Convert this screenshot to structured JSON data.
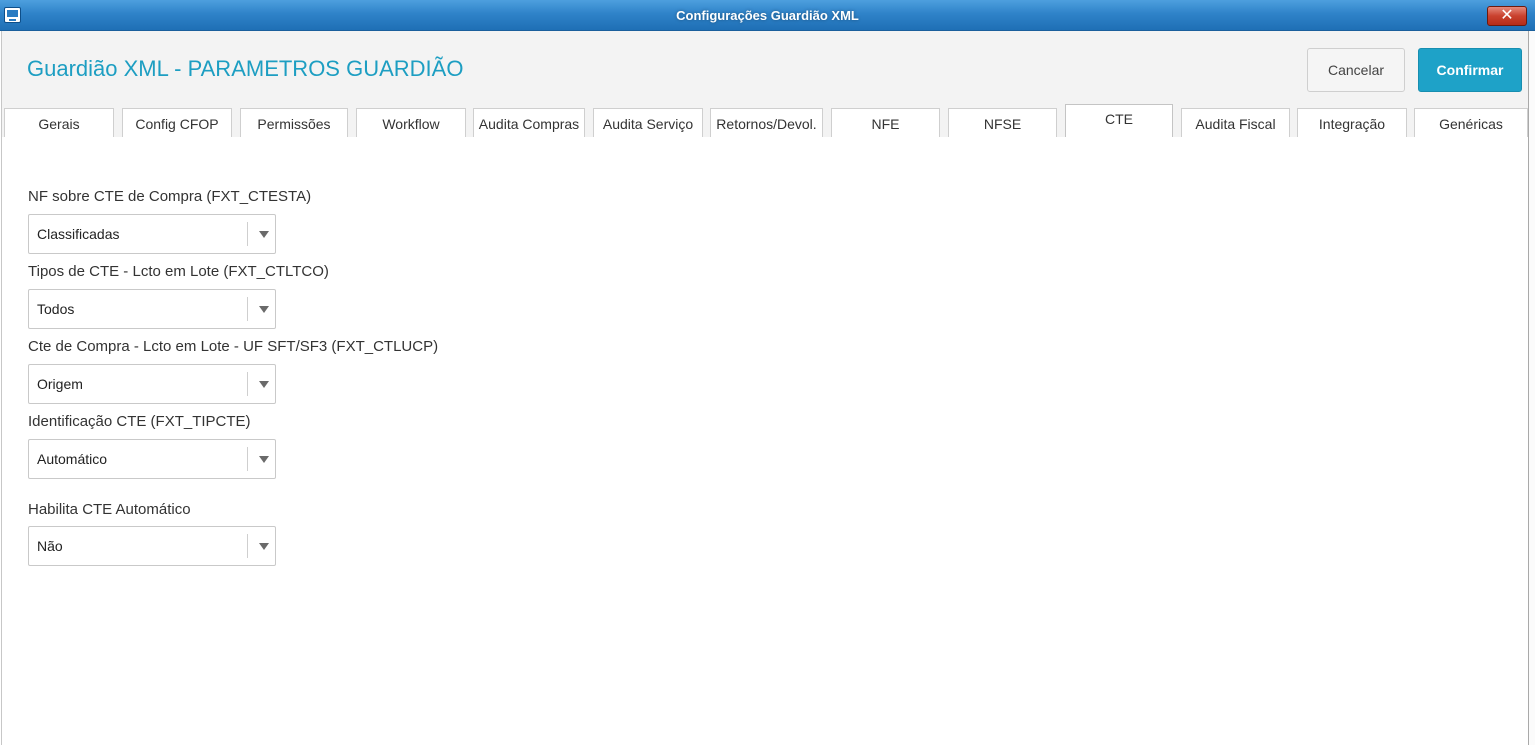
{
  "window": {
    "title": "Configurações Guardião XML",
    "close_label": "✕"
  },
  "header": {
    "title": "Guardião XML - PARAMETROS GUARDIÃO",
    "cancel_label": "Cancelar",
    "confirm_label": "Confirmar"
  },
  "tabs": [
    {
      "label": "Gerais"
    },
    {
      "label": "Config CFOP"
    },
    {
      "label": "Permissões"
    },
    {
      "label": "Workflow"
    },
    {
      "label": "Audita Compras"
    },
    {
      "label": "Audita Serviço"
    },
    {
      "label": "Retornos/Devol."
    },
    {
      "label": "NFE"
    },
    {
      "label": "NFSE"
    },
    {
      "label": "CTE",
      "active": true
    },
    {
      "label": "Audita Fiscal"
    },
    {
      "label": "Integração"
    },
    {
      "label": "Genéricas"
    }
  ],
  "fields": [
    {
      "label": "NF sobre CTE de Compra (FXT_CTESTA)",
      "value": "Classificadas"
    },
    {
      "label": "Tipos de CTE - Lcto em Lote (FXT_CTLTCO)",
      "value": "Todos"
    },
    {
      "label": "Cte de Compra - Lcto em Lote - UF SFT/SF3 (FXT_CTLUCP)",
      "value": "Origem"
    },
    {
      "label": "Identificação CTE (FXT_TIPCTE)",
      "value": "Automático"
    },
    {
      "label": "Habilita CTE Automático",
      "value": "Não"
    }
  ],
  "colors": {
    "titlebar": "#2f83c9",
    "title_text": "#1d9ec2",
    "confirm_button": "#1ea2c8",
    "close_button": "#c9412e"
  },
  "icons": {
    "app": "app-window-icon",
    "close": "close-icon",
    "dropdown": "chevron-down-icon"
  }
}
